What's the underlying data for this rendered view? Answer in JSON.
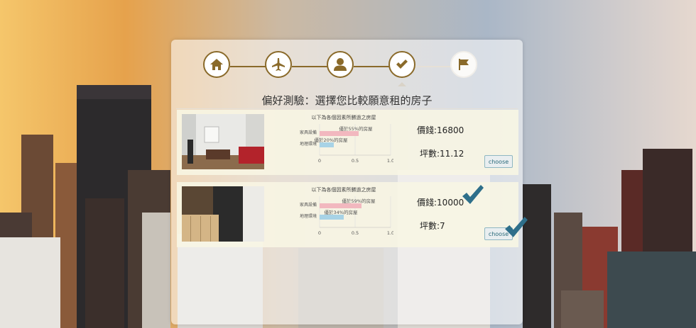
{
  "steps": [
    {
      "icon": "home-icon",
      "active": true
    },
    {
      "icon": "airplane-icon",
      "active": true
    },
    {
      "icon": "user-icon",
      "active": true
    },
    {
      "icon": "check-icon",
      "active": true
    },
    {
      "icon": "flag-icon",
      "active": false
    }
  ],
  "page": {
    "title": "偏好測驗：選擇您比較願意租的房子"
  },
  "cards": [
    {
      "chart_title": "以下為各個因素所勝過之房屋",
      "price_label": "價錢:16800",
      "area_label": "坪數:11.12",
      "choose_label": "choose",
      "selected": false,
      "chart_data": {
        "type": "bar",
        "categories": [
          "家具設備",
          "地理環境"
        ],
        "series": [
          {
            "values": [
              0.55,
              0.2
            ]
          }
        ],
        "annotations": [
          "優於55%的房屋",
          "優於20%的房屋"
        ],
        "ticks": [
          "0",
          "0.5",
          "1.0"
        ],
        "xlim": [
          0,
          1.0
        ]
      }
    },
    {
      "chart_title": "以下為各個因素所勝過之房屋",
      "price_label": "價錢:10000",
      "area_label": "坪數:7",
      "choose_label": "choose",
      "selected": true,
      "chart_data": {
        "type": "bar",
        "categories": [
          "家具設備",
          "地理環境"
        ],
        "series": [
          {
            "values": [
              0.59,
              0.34
            ]
          }
        ],
        "annotations": [
          "優於59%的房屋",
          "優於34%的房屋"
        ],
        "ticks": [
          "0",
          "0.5",
          "1.0"
        ],
        "xlim": [
          0,
          1.0
        ]
      }
    }
  ],
  "colors": {
    "step_border": "#8a6a2a",
    "check": "#2e6f8a",
    "bar_pink": "#f2b8bf",
    "bar_blue": "#a8d3e6"
  }
}
